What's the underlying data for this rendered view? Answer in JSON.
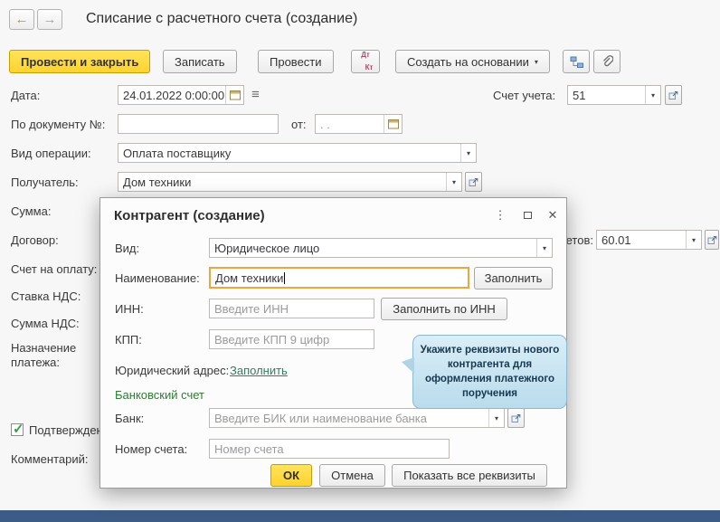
{
  "colors": {
    "accent_yellow": "#ffd22e",
    "focus_orange": "#f0a43c",
    "section_green": "#2e7d32",
    "link_green": "#2e7d64",
    "tooltip_blue": "#c9e6f4",
    "bottom_bar_blue": "#3d5c85",
    "check_green": "#35a043"
  },
  "icons": {
    "back_arrow": "←",
    "forward_arrow": "→",
    "chevron_down": "▾",
    "kebab_menu": "⋮",
    "close": "✕",
    "list_menu": "≡",
    "checkmark": "✓"
  },
  "header": {
    "title": "Списание с расчетного счета (создание)"
  },
  "toolbar": {
    "post_and_close": "Провести и закрыть",
    "write": "Записать",
    "post": "Провести",
    "dt": "Дт",
    "kt": "Кт",
    "create_based_on": "Создать на основании"
  },
  "form": {
    "date_label": "Дата:",
    "date_value": "24.01.2022  0:00:00",
    "account_label": "Счет учета:",
    "account_value": "51",
    "doc_number_label": "По документу №:",
    "doc_number_value": "",
    "from_label": "от:",
    "from_value": ".  .",
    "operation_label": "Вид операции:",
    "operation_value": "Оплата поставщику",
    "recipient_label": "Получатель:",
    "recipient_value": "Дом техники",
    "amount_label": "Сумма:",
    "contract_label": "Договор:",
    "settlement_label": "Счет расчетов:",
    "settlement_value": "60.01",
    "invoice_label": "Счет на оплату:",
    "vat_rate_label": "Ставка НДС:",
    "vat_amount_label": "Сумма НДС:",
    "purpose_label": "Назначение платежа:",
    "confirmed_label": "Подтверждено",
    "comment_label": "Комментарий:"
  },
  "modal": {
    "title": "Контрагент (создание)",
    "kind_label": "Вид:",
    "kind_value": "Юридическое лицо",
    "name_label": "Наименование:",
    "name_value": "Дом техники",
    "fill_button": "Заполнить",
    "inn_label": "ИНН:",
    "inn_placeholder": "Введите ИНН",
    "fill_by_inn_button": "Заполнить по ИНН",
    "kpp_label": "КПП:",
    "kpp_placeholder": "Введите КПП 9 цифр",
    "address_label": "Юридический адрес:",
    "address_link": "Заполнить",
    "bank_section_title": "Банковский счет",
    "bank_label": "Банк:",
    "bank_placeholder": "Введите БИК или наименование банка",
    "account_number_label": "Номер счета:",
    "account_number_placeholder": "Номер счета",
    "ok_button": "ОК",
    "cancel_button": "Отмена",
    "show_all_button": "Показать все реквизиты"
  },
  "tooltip": {
    "text": "Укажите реквизиты нового контрагента для оформления платежного поручения"
  }
}
